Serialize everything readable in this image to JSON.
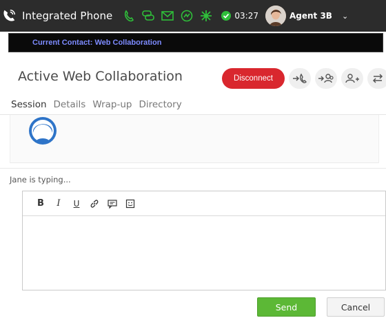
{
  "header": {
    "title": "Integrated Phone",
    "timer": "03:27",
    "agent_name": "Agent 3B",
    "icons": [
      "phone-icon",
      "chat-icon",
      "email-icon",
      "social-icon",
      "workitem-icon",
      "ready-status-icon"
    ],
    "accent_color": "#2fbf3a"
  },
  "contact_bar": {
    "label": "Current Contact: Web Collaboration",
    "label_color": "#7d8bff"
  },
  "section": {
    "title": "Active Web Collaboration",
    "disconnect_label": "Disconnect",
    "disconnect_color": "#d9272e",
    "action_icons": [
      "transfer-icon",
      "transfer-to-agent-icon",
      "add-participant-icon",
      "swap-icon"
    ]
  },
  "tabs": [
    {
      "label": "Session",
      "active": true
    },
    {
      "label": "Details",
      "active": false
    },
    {
      "label": "Wrap-up",
      "active": false
    },
    {
      "label": "Directory",
      "active": false
    }
  ],
  "chat": {
    "typing_text": "Jane is typing..."
  },
  "editor": {
    "toolbar": [
      {
        "name": "bold",
        "glyph": "B"
      },
      {
        "name": "italic",
        "glyph": "I"
      },
      {
        "name": "underline",
        "glyph": "U"
      },
      {
        "name": "link-icon",
        "glyph": ""
      },
      {
        "name": "canned-response-icon",
        "glyph": ""
      },
      {
        "name": "emoticon-icon",
        "glyph": ""
      }
    ],
    "value": "",
    "placeholder": ""
  },
  "actions": {
    "send_label": "Send",
    "cancel_label": "Cancel",
    "send_color": "#5cb836"
  }
}
